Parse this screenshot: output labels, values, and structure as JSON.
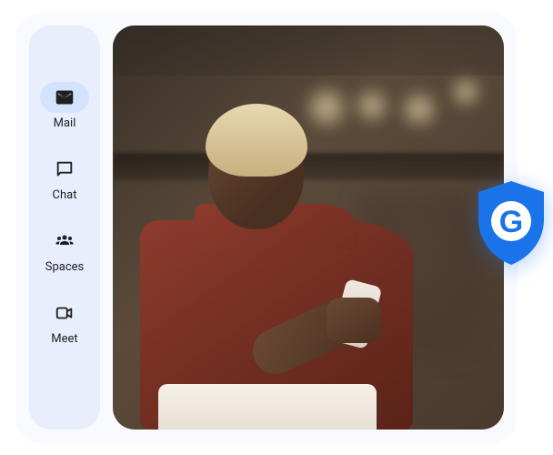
{
  "sidebar": {
    "items": [
      {
        "label": "Mail",
        "icon": "mail-icon",
        "active": true
      },
      {
        "label": "Chat",
        "icon": "chat-icon",
        "active": false
      },
      {
        "label": "Spaces",
        "icon": "spaces-icon",
        "active": false
      },
      {
        "label": "Meet",
        "icon": "meet-icon",
        "active": false
      }
    ]
  },
  "badge": {
    "name": "google-shield",
    "letter": "G",
    "color": "#1a73e8"
  },
  "image": {
    "description": "Person holding a smartphone in an office setting"
  }
}
